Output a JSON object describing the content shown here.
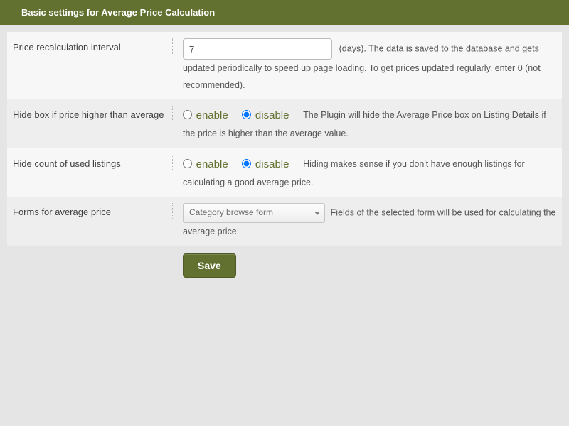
{
  "header": {
    "title": "Basic settings for Average Price Calculation"
  },
  "rows": {
    "interval": {
      "label": "Price recalculation interval",
      "value": "7",
      "help": "(days). The data is saved to the database and gets updated periodically to speed up page loading. To get prices updated regularly, enter 0 (not recommended)."
    },
    "hidebox": {
      "label": "Hide box if price higher than average",
      "enable": "enable",
      "disable": "disable",
      "selected": "disable",
      "help": "The Plugin will hide the Average Price box on Listing Details if the price is higher than the average value."
    },
    "hidecount": {
      "label": "Hide count of used listings",
      "enable": "enable",
      "disable": "disable",
      "selected": "disable",
      "help": "Hiding makes sense if you don't have enough listings for calculating a good average price."
    },
    "forms": {
      "label": "Forms for average price",
      "selectValue": "Category browse form",
      "help": "Fields of the selected form will be used for calculating the average price."
    }
  },
  "buttons": {
    "save": "Save"
  }
}
